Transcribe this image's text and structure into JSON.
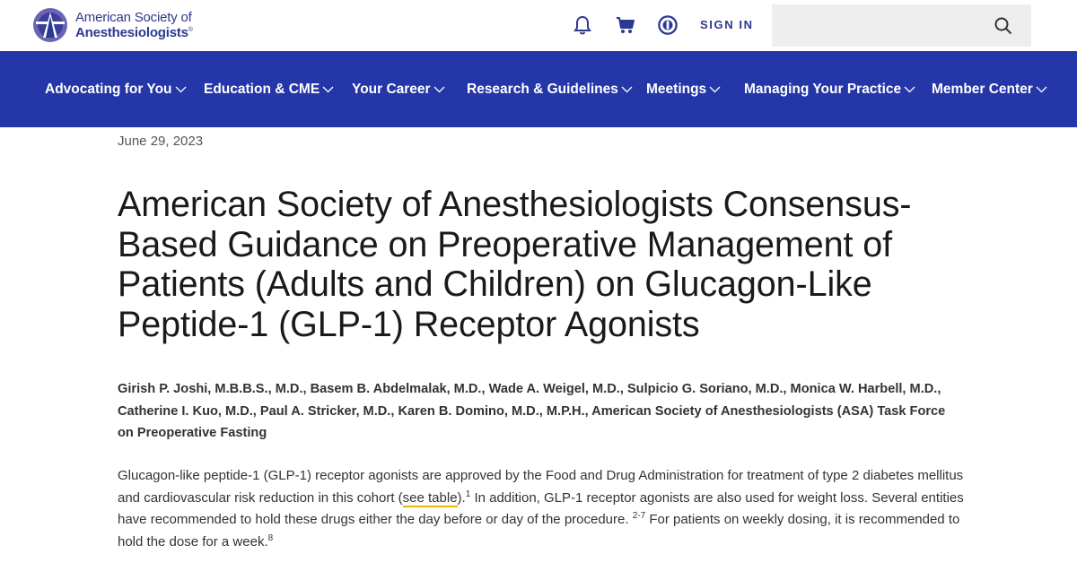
{
  "brand": {
    "line1": "American Society of",
    "line2": "Anesthesiologists",
    "mark": "®",
    "color": "#2b3990"
  },
  "header": {
    "icons": [
      "bell-icon",
      "cart-icon",
      "user-circle-icon"
    ],
    "signin_label": "SIGN IN",
    "search_placeholder": "",
    "search_icon": "search-icon"
  },
  "nav": {
    "background": "#2436a8",
    "items": [
      {
        "label": "Advocating for You"
      },
      {
        "label": "Education & CME"
      },
      {
        "label": "Your Career"
      },
      {
        "label": "Research & Guidelines"
      },
      {
        "label": "Meetings"
      },
      {
        "label": "Managing Your Practice"
      },
      {
        "label": "Member Center"
      }
    ]
  },
  "article": {
    "date": "June 29, 2023",
    "title": "American Society of Anesthesiologists Consensus-Based Guidance on Preoperative Management of Patients (Adults and Children) on Glucagon-Like Peptide-1 (GLP-1) Receptor Agonists",
    "authors": "Girish P. Joshi, M.B.B.S., M.D., Basem B. Abdelmalak, M.D., Wade A. Weigel, M.D., Sulpicio G. Soriano, M.D., Monica W. Harbell, M.D., Catherine I. Kuo, M.D., Paul A. Stricker, M.D., Karen B. Domino, M.D., M.P.H., American Society of Anesthesiologists (ASA) Task Force on Preoperative Fasting",
    "paragraph": {
      "part1": "Glucagon-like peptide-1 (GLP-1) receptor agonists are approved by the Food and Drug Administration for treatment of type 2 diabetes mellitus and cardiovascular risk reduction in this cohort (",
      "link": "see table",
      "part2": ").",
      "sup1": "1",
      "part3": " In addition, GLP-1 receptor agonists are also used for weight loss. Several entities have recommended to hold these drugs either the day before or day of the procedure. ",
      "sup2": "2-7",
      "part4": " For patients on weekly dosing, it is recommended to hold the dose for a week.",
      "sup3": "8"
    },
    "link_underline_color": "#e8b800"
  }
}
